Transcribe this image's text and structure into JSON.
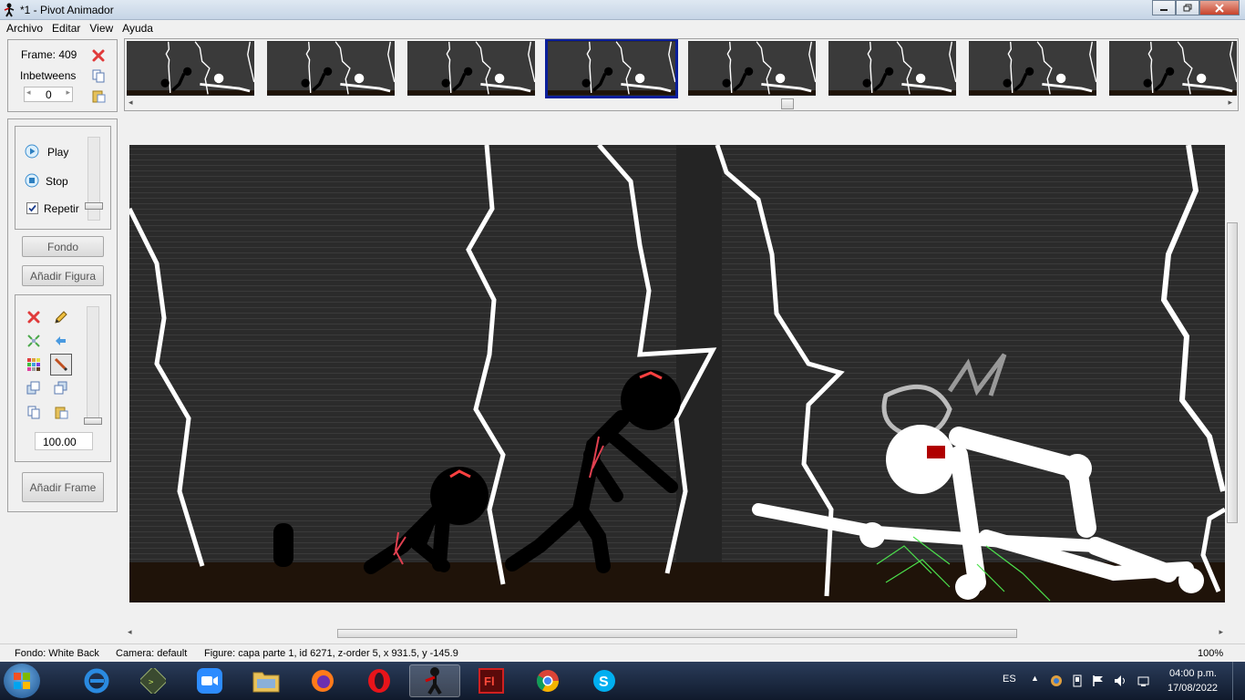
{
  "window": {
    "title": "*1 - Pivot Animador"
  },
  "menu": [
    "Archivo",
    "Editar",
    "View",
    "Ayuda"
  ],
  "frame_panel": {
    "frame_label": "Frame: 409",
    "inbetweens_label": "Inbetweens",
    "inbetweens_value": "0"
  },
  "playback": {
    "play_label": "Play",
    "stop_label": "Stop",
    "repeat_label": "Repetir",
    "repeat_checked": true
  },
  "buttons": {
    "fondo": "Fondo",
    "add_figure": "Añadir Figura",
    "add_frame": "Añadir Frame"
  },
  "tools": {
    "scale_value": "100.00"
  },
  "status": {
    "fondo": "Fondo: White Back",
    "camera": "Camera: default",
    "figure": "Figure: capa parte 1,  id 6271,  z-order 5,  x 931.5, y -145.9",
    "zoom": "100%"
  },
  "taskbar": {
    "language": "ES",
    "time": "04:00 p.m.",
    "date": "17/08/2022"
  },
  "thumbnails": {
    "count": 8,
    "selected_index": 3
  }
}
